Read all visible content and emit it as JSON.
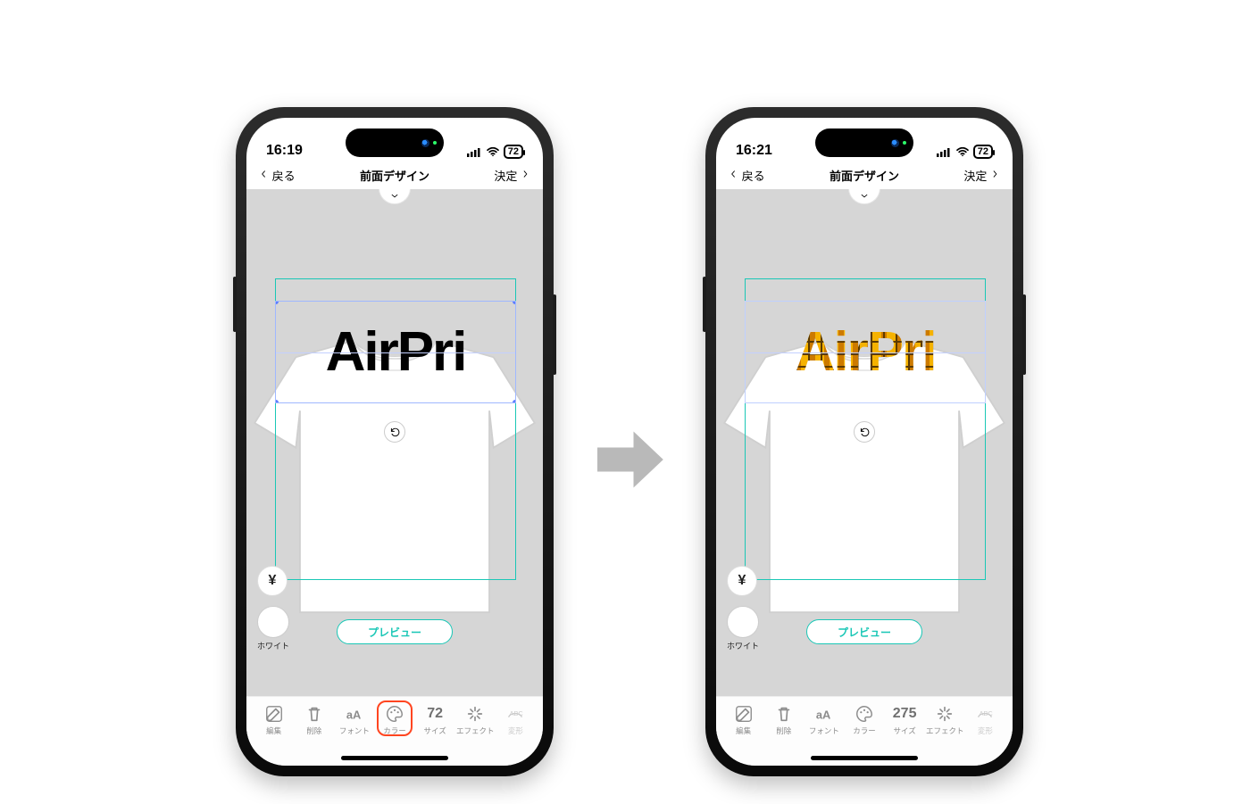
{
  "phoneA": {
    "status": {
      "time": "16:19",
      "battery": "72"
    },
    "nav": {
      "back": "戻る",
      "title": "前面デザイン",
      "confirm": "決定"
    },
    "design_text": "AirPri",
    "preview_button": "プレビュー",
    "swatch_label": "ホワイト",
    "yen_symbol": "¥",
    "toolbar": {
      "items": [
        {
          "id": "edit",
          "label": "編集"
        },
        {
          "id": "delete",
          "label": "削除"
        },
        {
          "id": "font",
          "label": "フォント"
        },
        {
          "id": "color",
          "label": "カラー",
          "highlight": true
        },
        {
          "id": "size",
          "label": "サイズ",
          "value": "72"
        },
        {
          "id": "effect",
          "label": "エフェクト"
        },
        {
          "id": "transform",
          "label": "変形"
        }
      ]
    }
  },
  "phoneB": {
    "status": {
      "time": "16:21",
      "battery": "72"
    },
    "nav": {
      "back": "戻る",
      "title": "前面デザイン",
      "confirm": "決定"
    },
    "design_text": "AirPri",
    "preview_button": "プレビュー",
    "swatch_label": "ホワイト",
    "yen_symbol": "¥",
    "toolbar": {
      "items": [
        {
          "id": "edit",
          "label": "編集"
        },
        {
          "id": "delete",
          "label": "削除"
        },
        {
          "id": "font",
          "label": "フォント"
        },
        {
          "id": "color",
          "label": "カラー"
        },
        {
          "id": "size",
          "label": "サイズ",
          "value": "275"
        },
        {
          "id": "effect",
          "label": "エフェクト"
        },
        {
          "id": "transform",
          "label": "変形"
        }
      ]
    }
  }
}
